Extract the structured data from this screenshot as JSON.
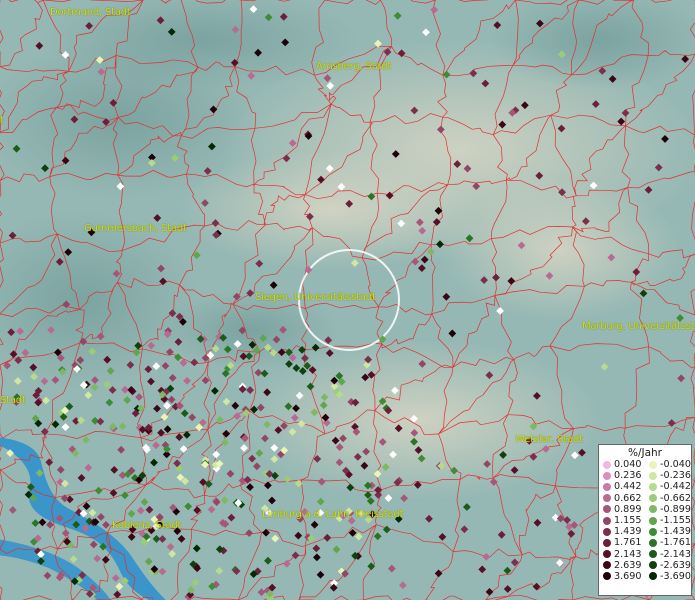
{
  "cities": [
    {
      "name": "Dortmund, Stadt"
    },
    {
      "name": "Arnsberg, Stadt"
    },
    {
      "name": "Gummersbach, Stadt"
    },
    {
      "name": "Siegen, Universitätsstadt"
    },
    {
      "name": "Marburg, Universitätsstadt"
    },
    {
      "name": "Stadt"
    },
    {
      "name": "Wetzlar, Stadt"
    },
    {
      "name": "Koblenz, Stadt"
    },
    {
      "name": "Limburg a.d. Lahn, Kreisstadt"
    },
    {
      "name": "t"
    }
  ],
  "legend": {
    "title": "%/Jahr",
    "positive": [
      "0.040",
      "0.236",
      "0.442",
      "0.662",
      "0.899",
      "1.155",
      "1.439",
      "1.761",
      "2.143",
      "2.639",
      "3.690"
    ],
    "negative": [
      "-0.040",
      "-0.236",
      "-0.442",
      "-0.662",
      "-0.899",
      "-1.155",
      "-1.439",
      "-1.761",
      "-2.143",
      "-2.639",
      "-3.690"
    ],
    "positive_colors": [
      "#f3b6e3",
      "#d98fbf",
      "#c97aa8",
      "#b86b92",
      "#a55679",
      "#934766",
      "#7c2f4c",
      "#6b1f3a",
      "#560f26",
      "#3d0616",
      "#1f0008"
    ],
    "negative_colors": [
      "#e9f4b8",
      "#cfe7a0",
      "#b7da8c",
      "#9dcb78",
      "#7db964",
      "#5fa64d",
      "#3e8c36",
      "#2a7426",
      "#1c5b1a",
      "#0f4010",
      "#042805"
    ]
  },
  "colors": {
    "boundary": "#e03030",
    "label": "#d8e000",
    "water": "#2b8fcf"
  }
}
